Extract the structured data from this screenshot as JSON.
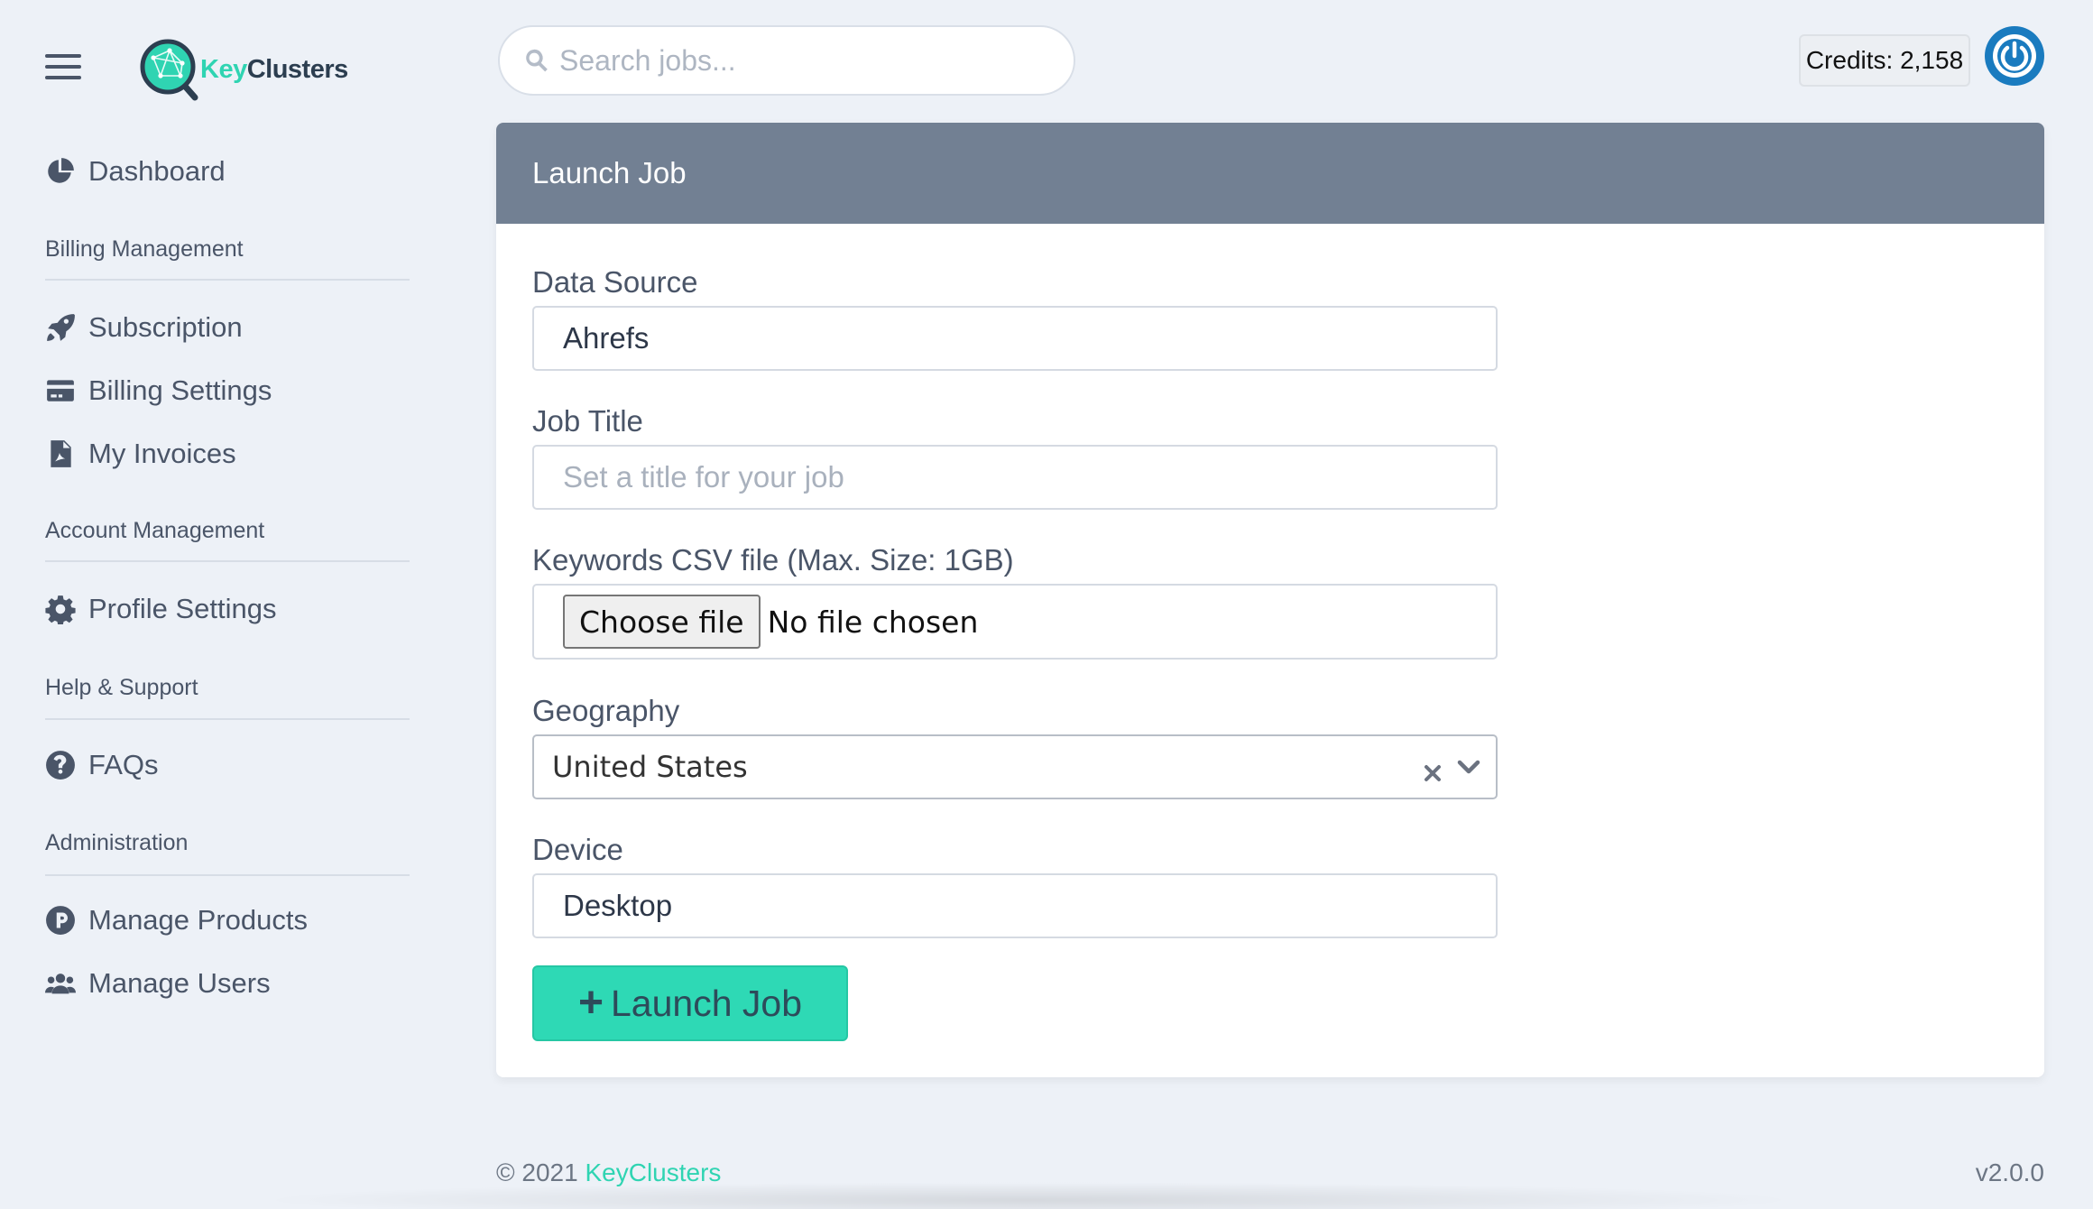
{
  "app": {
    "logo_key": "Key",
    "logo_clusters": "Clusters"
  },
  "sidebar": {
    "sections": [
      {
        "label": "Billing Management"
      },
      {
        "label": "Account Management"
      },
      {
        "label": "Help & Support"
      },
      {
        "label": "Administration"
      }
    ],
    "items": [
      {
        "label": "Dashboard",
        "icon": "pie-chart-icon"
      },
      {
        "label": "Subscription",
        "icon": "rocket-icon"
      },
      {
        "label": "Billing Settings",
        "icon": "credit-card-icon"
      },
      {
        "label": "My Invoices",
        "icon": "pdf-file-icon"
      },
      {
        "label": "Profile Settings",
        "icon": "gear-icon"
      },
      {
        "label": "FAQs",
        "icon": "question-circle-icon"
      },
      {
        "label": "Manage Products",
        "icon": "product-p-icon"
      },
      {
        "label": "Manage Users",
        "icon": "users-icon"
      }
    ]
  },
  "header": {
    "search_placeholder": "Search jobs...",
    "credits": "Credits: 2,158"
  },
  "card": {
    "title": "Launch Job",
    "fields": {
      "data_source": {
        "label": "Data Source",
        "value": "Ahrefs"
      },
      "job_title": {
        "label": "Job Title",
        "placeholder": "Set a title for your job"
      },
      "keywords_csv": {
        "label": "Keywords CSV file (Max. Size: 1GB)",
        "button": "Choose file",
        "status": "No file chosen"
      },
      "geography": {
        "label": "Geography",
        "value": "United States"
      },
      "device": {
        "label": "Device",
        "value": "Desktop"
      }
    },
    "submit_label": "Launch Job"
  },
  "footer": {
    "copyright": "© 2021",
    "brand": "KeyClusters",
    "version": "v2.0.0"
  },
  "colors": {
    "accent": "#2ed9b5",
    "header_bar": "#728093",
    "power_button": "#1a7bbf",
    "background": "#edf1f7"
  }
}
